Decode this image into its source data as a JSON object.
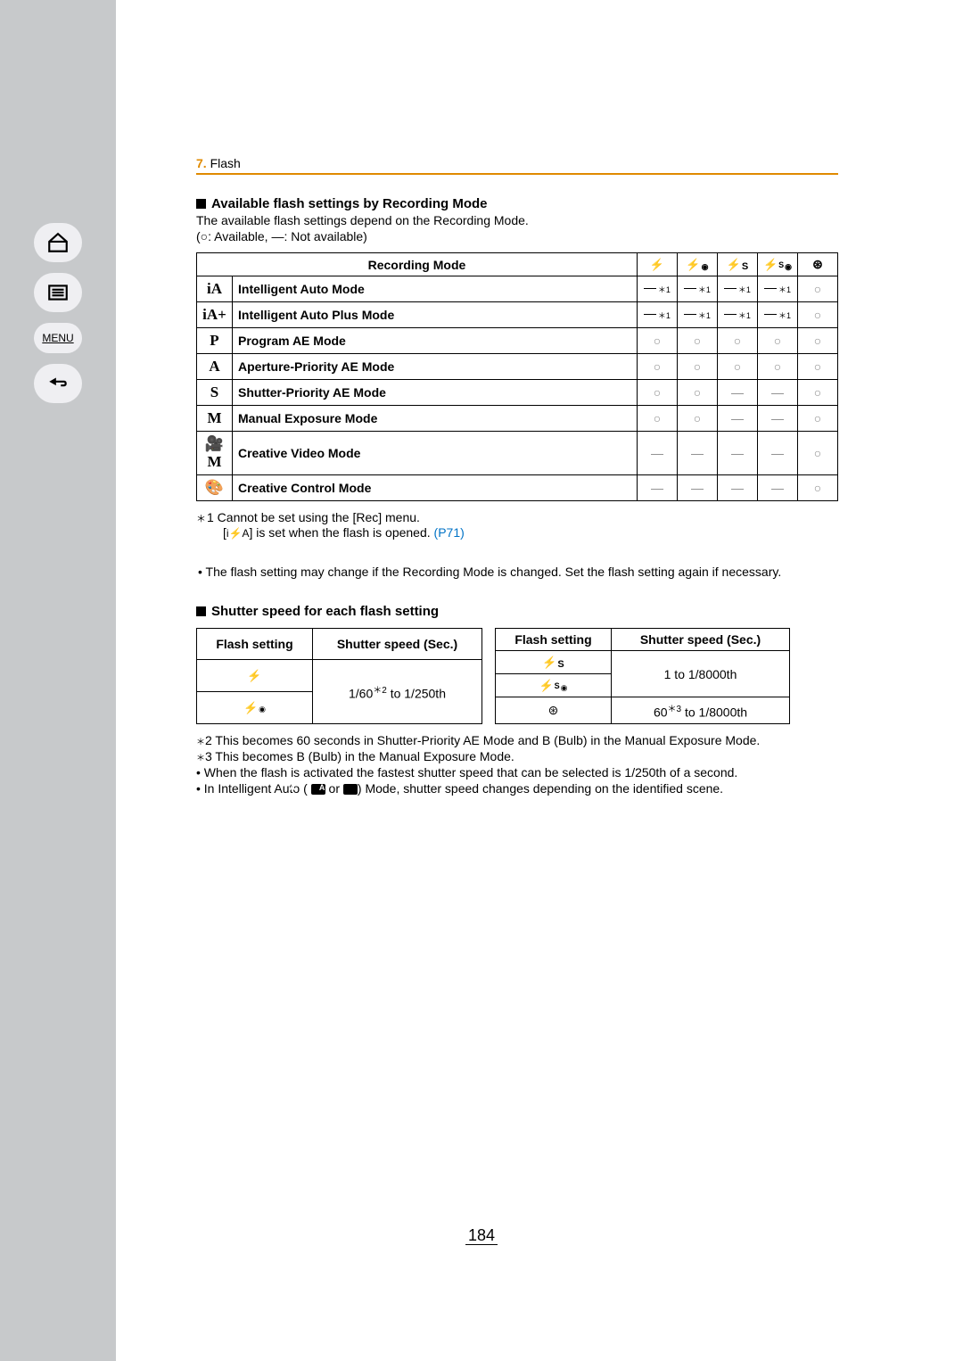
{
  "header": {
    "section_num": "7.",
    "section_title": "Flash"
  },
  "sub1": {
    "title": "Available flash settings by Recording Mode",
    "desc": "The available flash settings depend on the Recording Mode.",
    "legend_text": "(○:  Available, ―:  Not available)",
    "table_head": "Recording Mode",
    "cols": [
      "⚡",
      "⚡◉",
      "⚡S",
      "⚡S◉",
      "⊛"
    ],
    "rows": [
      {
        "icon": "iA",
        "name": "Intelligent Auto Mode",
        "cells": [
          "ast",
          "ast",
          "ast",
          "ast",
          "circ"
        ]
      },
      {
        "icon": "iA+",
        "name": "Intelligent Auto Plus Mode",
        "cells": [
          "ast",
          "ast",
          "ast",
          "ast",
          "circ"
        ]
      },
      {
        "icon": "P",
        "name": "Program AE Mode",
        "cells": [
          "circ",
          "circ",
          "circ",
          "circ",
          "circ"
        ]
      },
      {
        "icon": "A",
        "name": "Aperture-Priority AE Mode",
        "cells": [
          "circ",
          "circ",
          "circ",
          "circ",
          "circ"
        ]
      },
      {
        "icon": "S",
        "name": "Shutter-Priority AE Mode",
        "cells": [
          "circ",
          "circ",
          "dash",
          "dash",
          "circ"
        ]
      },
      {
        "icon": "M",
        "name": "Manual Exposure Mode",
        "cells": [
          "circ",
          "circ",
          "dash",
          "dash",
          "circ"
        ]
      },
      {
        "icon": "🎥M",
        "name": "Creative Video Mode",
        "cells": [
          "dash",
          "dash",
          "dash",
          "dash",
          "circ"
        ]
      },
      {
        "icon": "🎨",
        "name": "Creative Control Mode",
        "cells": [
          "dash",
          "dash",
          "dash",
          "dash",
          "circ"
        ]
      }
    ],
    "fn1a": "1 Cannot be set using the [Rec] menu.",
    "fn1b_pre": "[",
    "fn1b_icon": "i⚡A",
    "fn1b_post": "] is set when the flash is opened. ",
    "fn1b_link": "(P71)",
    "note": "The flash setting may change if the Recording Mode is changed. Set the flash setting again if necessary."
  },
  "sub2": {
    "title": "Shutter speed for each flash setting",
    "h_fs": "Flash setting",
    "h_ss": "Shutter speed (Sec.)",
    "left_speed": "1/60",
    "left_speed_sup": "＊2",
    "left_speed_tail": " to 1/250th",
    "right_speed1": "1 to 1/8000th",
    "right_speed2_pre": "60",
    "right_speed2_sup": "＊3",
    "right_speed2_tail": " to 1/8000th",
    "fn2": "2 This becomes 60 seconds in Shutter-Priority AE Mode and B (Bulb) in the Manual Exposure Mode.",
    "fn3": "3 This becomes B (Bulb) in the Manual Exposure Mode.",
    "b1": "When the flash is activated the fastest shutter speed that can be selected is 1/250th of a second.",
    "b2_pre": "In Intelligent Auto ( ",
    "b2_mid": " or ",
    "b2_post": ") Mode, shutter speed changes depending on the identified scene."
  },
  "page": "184"
}
